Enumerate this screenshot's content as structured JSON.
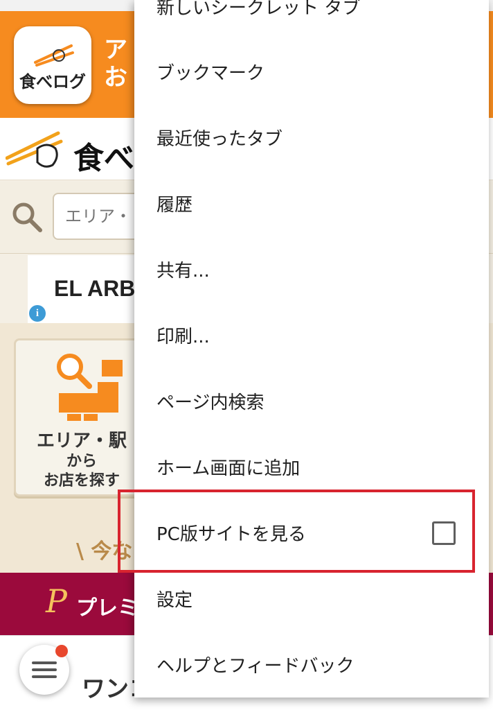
{
  "app_banner": {
    "icon_label": "食べログ",
    "text_line1": "ア",
    "text_line2": "お"
  },
  "site_logo": {
    "text": "食べ"
  },
  "search": {
    "placeholder": "エリア・"
  },
  "ad": {
    "text": "EL ARB",
    "info_icon": "i"
  },
  "area_card": {
    "line1": "エリア・駅",
    "line2": "から",
    "line3": "お店を探す"
  },
  "partial_headline": "\\ 今な",
  "premium": {
    "p_mark": "P",
    "label": "プレミ"
  },
  "bottom": {
    "label": "ワンコ"
  },
  "menu": {
    "items": [
      {
        "label": "新しいシークレット タブ"
      },
      {
        "label": "ブックマーク"
      },
      {
        "label": "最近使ったタブ"
      },
      {
        "label": "履歴"
      },
      {
        "label": "共有..."
      },
      {
        "label": "印刷..."
      },
      {
        "label": "ページ内検索"
      },
      {
        "label": "ホーム画面に追加"
      },
      {
        "label": "PC版サイトを見る",
        "checkbox": false
      },
      {
        "label": "設定"
      },
      {
        "label": "ヘルプとフィードバック"
      }
    ]
  },
  "colors": {
    "banner_orange": "#f68b1f",
    "premium_crimson": "#9b0a3c",
    "highlight_red": "#d8242f"
  }
}
